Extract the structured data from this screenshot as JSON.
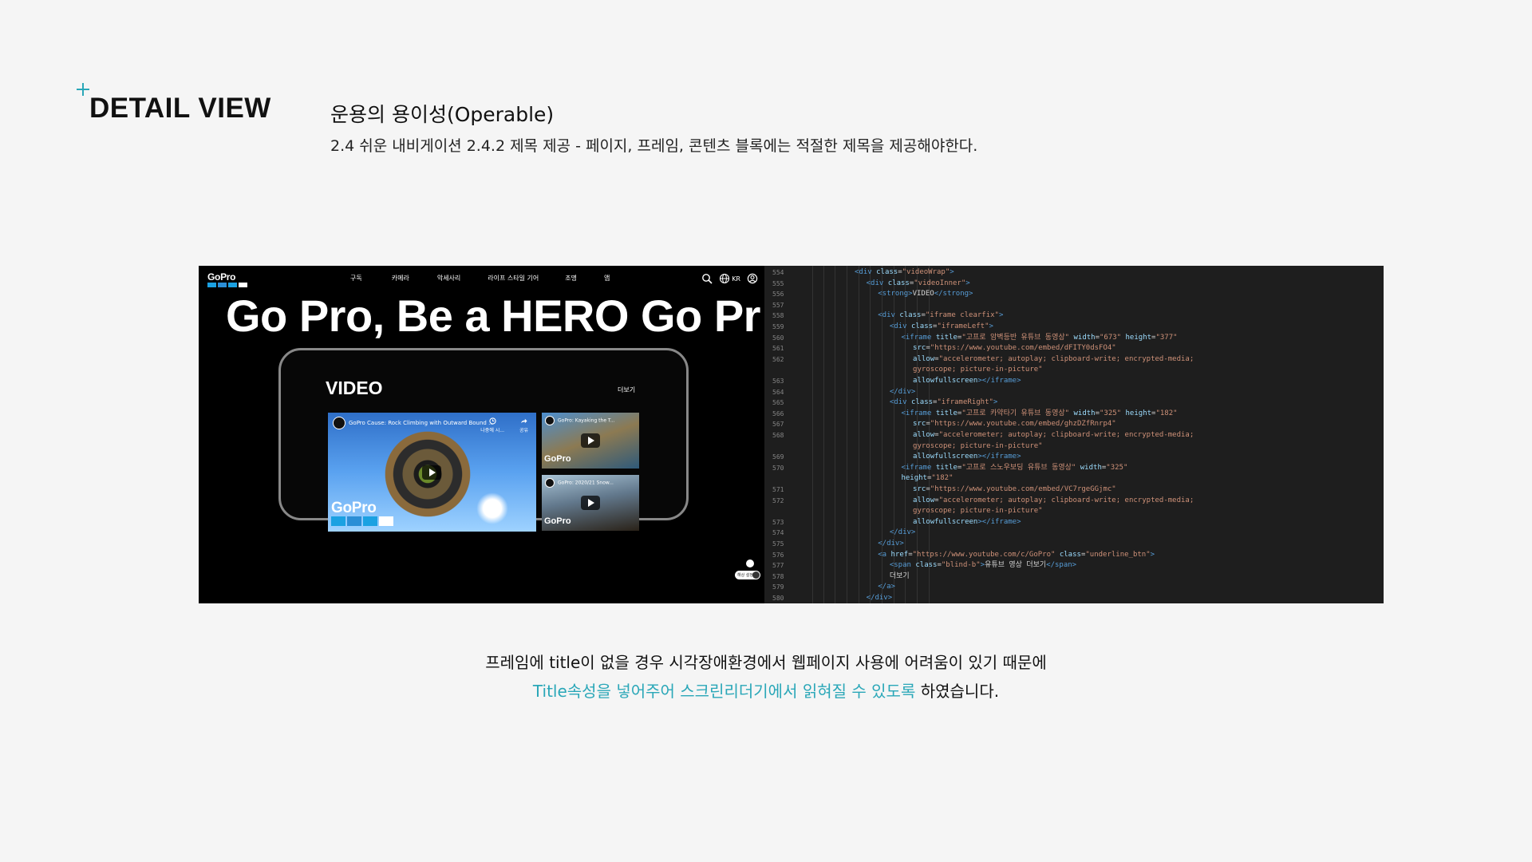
{
  "section": {
    "title": "DETAIL VIEW",
    "accent": "#2aa7b8"
  },
  "header": {
    "heading": "운용의 용이성(Operable)",
    "subtext": "2.4 쉬운 내비게이션 2.4.2 제목 제공 - 페이지, 프레임, 콘텐츠 블록에는 적절한 제목을 제공해야한다."
  },
  "screenshot": {
    "site": {
      "logo": "GoPro",
      "nav": [
        "구독",
        "카메라",
        "악세사리",
        "라이프 스타일 기어",
        "조명",
        "앱"
      ],
      "lang": "KR",
      "hero": "Go Pro, Be a HERO Go Pr",
      "video_heading": "VIDEO",
      "more": "더보기",
      "main_video_title": "GoPro Cause: Rock Climbing with Outward Bound ...",
      "main_video_logo": "GoPro",
      "main_video_watch_later": "나중에 시...",
      "main_video_share": "공유",
      "thumb1_title": "GoPro: Kayaking the T...",
      "thumb2_title": "GoPro: 2020/21 Snow...",
      "thumb_logo": "GoPro",
      "toggle_label": "해상 설정"
    },
    "code": {
      "lines": [
        {
          "n": "554",
          "indent": 10,
          "html": "<span class=\"tag\">&lt;div</span> <span class=\"attr\">class</span>=<span class=\"str\">\"videoWrap\"</span><span class=\"tag\">&gt;</span>"
        },
        {
          "n": "555",
          "indent": 12,
          "html": "<span class=\"tag\">&lt;div</span> <span class=\"attr\">class</span>=<span class=\"str\">\"videoInner\"</span><span class=\"tag\">&gt;</span>"
        },
        {
          "n": "556",
          "indent": 14,
          "html": "<span class=\"tag\">&lt;strong&gt;</span>VIDEO<span class=\"tag\">&lt;/strong&gt;</span>"
        },
        {
          "n": "557",
          "indent": 0,
          "html": ""
        },
        {
          "n": "558",
          "indent": 14,
          "html": "<span class=\"tag\">&lt;div</span> <span class=\"attr\">class</span>=<span class=\"str\">\"iframe clearfix\"</span><span class=\"tag\">&gt;</span>"
        },
        {
          "n": "559",
          "indent": 16,
          "html": "<span class=\"tag\">&lt;div</span> <span class=\"attr\">class</span>=<span class=\"str\">\"iframeLeft\"</span><span class=\"tag\">&gt;</span>"
        },
        {
          "n": "560",
          "indent": 18,
          "html": "<span class=\"tag\">&lt;iframe</span> <span class=\"attr\">title</span>=<span class=\"str\">\"고프로 암벽등반 유튜브 동영상\"</span> <span class=\"attr\">width</span>=<span class=\"str\">\"673\"</span> <span class=\"attr\">height</span>=<span class=\"str\">\"377\"</span>"
        },
        {
          "n": "561",
          "indent": 20,
          "html": "<span class=\"attr\">src</span>=<span class=\"str\">\"https://www.youtube.com/embed/dFITY0dsFO4\"</span>"
        },
        {
          "n": "562",
          "indent": 20,
          "html": "<span class=\"attr\">allow</span>=<span class=\"str\">\"accelerometer; autoplay; clipboard-write; encrypted-media;</span>"
        },
        {
          "n": "",
          "indent": 20,
          "html": "<span class=\"str\">gyroscope; picture-in-picture\"</span>"
        },
        {
          "n": "563",
          "indent": 20,
          "html": "<span class=\"attr\">allowfullscreen</span><span class=\"tag\">&gt;&lt;/iframe&gt;</span>"
        },
        {
          "n": "564",
          "indent": 16,
          "html": "<span class=\"tag\">&lt;/div&gt;</span>"
        },
        {
          "n": "565",
          "indent": 16,
          "html": "<span class=\"tag\">&lt;div</span> <span class=\"attr\">class</span>=<span class=\"str\">\"iframeRight\"</span><span class=\"tag\">&gt;</span>"
        },
        {
          "n": "566",
          "indent": 18,
          "html": "<span class=\"tag\">&lt;iframe</span> <span class=\"attr\">title</span>=<span class=\"str\">\"고프로 카약타기 유튜브 동영상\"</span> <span class=\"attr\">width</span>=<span class=\"str\">\"325\"</span> <span class=\"attr\">height</span>=<span class=\"str\">\"182\"</span>"
        },
        {
          "n": "567",
          "indent": 20,
          "html": "<span class=\"attr\">src</span>=<span class=\"str\">\"https://www.youtube.com/embed/ghzDZfRnrp4\"</span>"
        },
        {
          "n": "568",
          "indent": 20,
          "html": "<span class=\"attr\">allow</span>=<span class=\"str\">\"accelerometer; autoplay; clipboard-write; encrypted-media;</span>"
        },
        {
          "n": "",
          "indent": 20,
          "html": "<span class=\"str\">gyroscope; picture-in-picture\"</span>"
        },
        {
          "n": "569",
          "indent": 20,
          "html": "<span class=\"attr\">allowfullscreen</span><span class=\"tag\">&gt;&lt;/iframe&gt;</span>"
        },
        {
          "n": "570",
          "indent": 18,
          "html": "<span class=\"tag\">&lt;iframe</span> <span class=\"attr\">title</span>=<span class=\"str\">\"고프로 스노우보딩 유튜브 동영상\"</span> <span class=\"attr\">width</span>=<span class=\"str\">\"325\"</span>"
        },
        {
          "n": "",
          "indent": 18,
          "html": "<span class=\"attr\">height</span>=<span class=\"str\">\"182\"</span>"
        },
        {
          "n": "571",
          "indent": 20,
          "html": "<span class=\"attr\">src</span>=<span class=\"str\">\"https://www.youtube.com/embed/VC7rgeGGjmc\"</span>"
        },
        {
          "n": "572",
          "indent": 20,
          "html": "<span class=\"attr\">allow</span>=<span class=\"str\">\"accelerometer; autoplay; clipboard-write; encrypted-media;</span>"
        },
        {
          "n": "",
          "indent": 20,
          "html": "<span class=\"str\">gyroscope; picture-in-picture\"</span>"
        },
        {
          "n": "573",
          "indent": 20,
          "html": "<span class=\"attr\">allowfullscreen</span><span class=\"tag\">&gt;&lt;/iframe&gt;</span>"
        },
        {
          "n": "574",
          "indent": 16,
          "html": "<span class=\"tag\">&lt;/div&gt;</span>"
        },
        {
          "n": "575",
          "indent": 14,
          "html": "<span class=\"tag\">&lt;/div&gt;</span>"
        },
        {
          "n": "576",
          "indent": 14,
          "html": "<span class=\"tag\">&lt;a</span> <span class=\"attr\">href</span>=<span class=\"str\">\"https://www.youtube.com/c/GoPro\"</span> <span class=\"attr\">class</span>=<span class=\"str\">\"underline_btn\"</span><span class=\"tag\">&gt;</span>"
        },
        {
          "n": "577",
          "indent": 16,
          "html": "<span class=\"tag\">&lt;span</span> <span class=\"attr\">class</span>=<span class=\"str\">\"blind-b\"</span><span class=\"tag\">&gt;</span>유튜브 영상 더보기<span class=\"tag\">&lt;/span&gt;</span>"
        },
        {
          "n": "578",
          "indent": 16,
          "html": "<span class=\"txt\">더보기</span>"
        },
        {
          "n": "579",
          "indent": 14,
          "html": "<span class=\"tag\">&lt;/a&gt;</span>"
        },
        {
          "n": "580",
          "indent": 12,
          "html": "<span class=\"tag\">&lt;/div&gt;</span>"
        }
      ]
    }
  },
  "description": {
    "line1": "프레임에 title이 없을 경우 시각장애환경에서 웹페이지 사용에 어려움이 있기 때문에",
    "line2_highlight": "Title속성을 넣어주어 스크린리더기에서 읽혀질 수 있도록",
    "line2_rest": " 하였습니다."
  }
}
